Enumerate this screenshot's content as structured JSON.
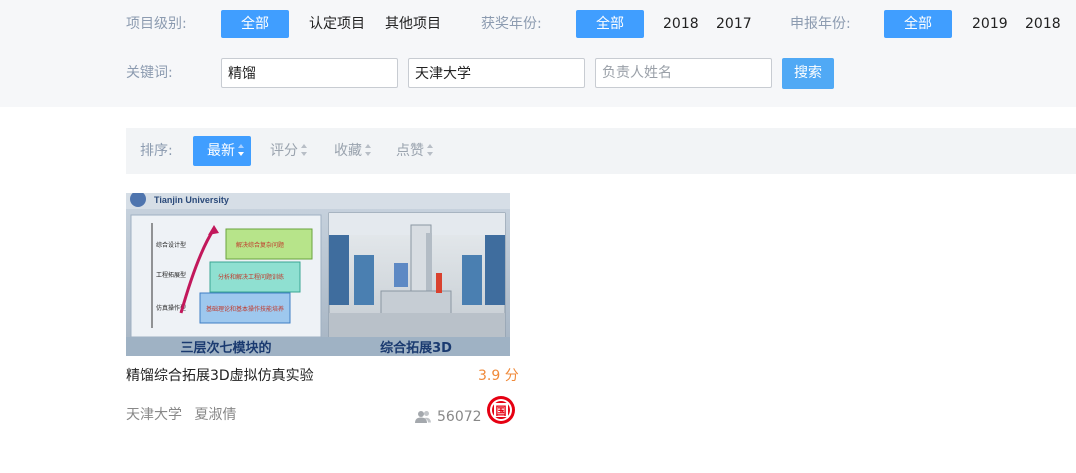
{
  "filters": {
    "level": {
      "label": "项目级别:",
      "options": [
        "全部",
        "认定项目",
        "其他项目"
      ]
    },
    "award_year": {
      "label": "获奖年份:",
      "options": [
        "全部",
        "2018",
        "2017"
      ]
    },
    "apply_year": {
      "label": "申报年份:",
      "options": [
        "全部",
        "2019",
        "2018"
      ]
    },
    "keyword": {
      "label": "关键词:",
      "inputs": [
        {
          "value": "精馏",
          "placeholder": ""
        },
        {
          "value": "天津大学",
          "placeholder": ""
        },
        {
          "value": "",
          "placeholder": "负责人姓名"
        }
      ],
      "search_label": "搜索"
    }
  },
  "sort": {
    "label": "排序:",
    "items": [
      "最新",
      "评分",
      "收藏",
      "点赞"
    ],
    "active": "最新"
  },
  "card": {
    "thumbnail": {
      "header_text": "Tianjin University",
      "left_caption": "三层次七模块的",
      "right_caption": "综合拓展3D",
      "levels": [
        "综合设计型",
        "工程拓展型",
        "仿真操作型"
      ],
      "blocks": [
        "解决综合复杂问题",
        "分析和解决工程问题训练",
        "基础理论和基本操作技能培养"
      ]
    },
    "title": "精馏综合拓展3D虚拟仿真实验",
    "score": "3.9 分",
    "university": "天津大学",
    "owner": "夏淑倩",
    "views": "56072",
    "badge_text": "国"
  },
  "colors": {
    "accent": "#409eff",
    "score": "#f08a3a",
    "badge": "#e60012"
  }
}
